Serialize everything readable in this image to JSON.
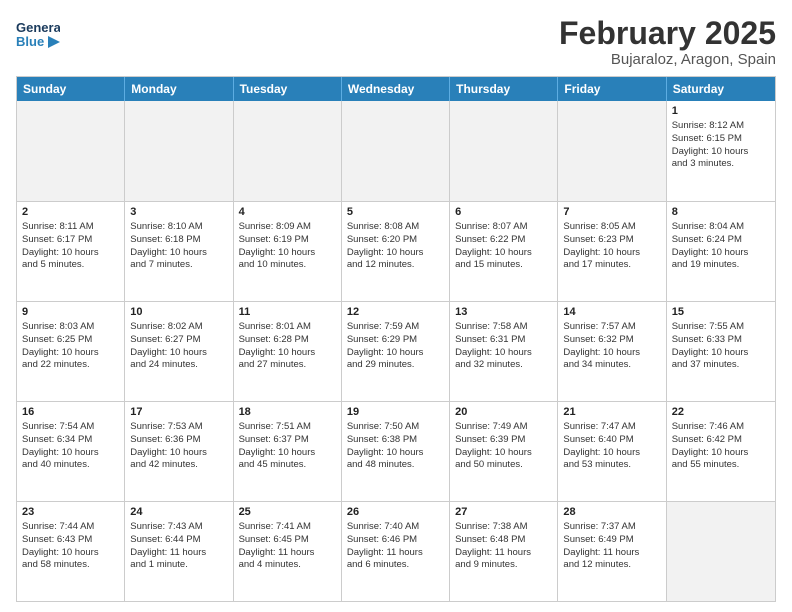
{
  "header": {
    "logo_general": "General",
    "logo_blue": "Blue",
    "month": "February 2025",
    "location": "Bujaraloz, Aragon, Spain"
  },
  "days_of_week": [
    "Sunday",
    "Monday",
    "Tuesday",
    "Wednesday",
    "Thursday",
    "Friday",
    "Saturday"
  ],
  "weeks": [
    [
      {
        "day": "",
        "info": "",
        "shaded": true
      },
      {
        "day": "",
        "info": "",
        "shaded": true
      },
      {
        "day": "",
        "info": "",
        "shaded": true
      },
      {
        "day": "",
        "info": "",
        "shaded": true
      },
      {
        "day": "",
        "info": "",
        "shaded": true
      },
      {
        "day": "",
        "info": "",
        "shaded": true
      },
      {
        "day": "1",
        "info": "Sunrise: 8:12 AM\nSunset: 6:15 PM\nDaylight: 10 hours\nand 3 minutes.",
        "shaded": false
      }
    ],
    [
      {
        "day": "2",
        "info": "Sunrise: 8:11 AM\nSunset: 6:17 PM\nDaylight: 10 hours\nand 5 minutes.",
        "shaded": false
      },
      {
        "day": "3",
        "info": "Sunrise: 8:10 AM\nSunset: 6:18 PM\nDaylight: 10 hours\nand 7 minutes.",
        "shaded": false
      },
      {
        "day": "4",
        "info": "Sunrise: 8:09 AM\nSunset: 6:19 PM\nDaylight: 10 hours\nand 10 minutes.",
        "shaded": false
      },
      {
        "day": "5",
        "info": "Sunrise: 8:08 AM\nSunset: 6:20 PM\nDaylight: 10 hours\nand 12 minutes.",
        "shaded": false
      },
      {
        "day": "6",
        "info": "Sunrise: 8:07 AM\nSunset: 6:22 PM\nDaylight: 10 hours\nand 15 minutes.",
        "shaded": false
      },
      {
        "day": "7",
        "info": "Sunrise: 8:05 AM\nSunset: 6:23 PM\nDaylight: 10 hours\nand 17 minutes.",
        "shaded": false
      },
      {
        "day": "8",
        "info": "Sunrise: 8:04 AM\nSunset: 6:24 PM\nDaylight: 10 hours\nand 19 minutes.",
        "shaded": false
      }
    ],
    [
      {
        "day": "9",
        "info": "Sunrise: 8:03 AM\nSunset: 6:25 PM\nDaylight: 10 hours\nand 22 minutes.",
        "shaded": false
      },
      {
        "day": "10",
        "info": "Sunrise: 8:02 AM\nSunset: 6:27 PM\nDaylight: 10 hours\nand 24 minutes.",
        "shaded": false
      },
      {
        "day": "11",
        "info": "Sunrise: 8:01 AM\nSunset: 6:28 PM\nDaylight: 10 hours\nand 27 minutes.",
        "shaded": false
      },
      {
        "day": "12",
        "info": "Sunrise: 7:59 AM\nSunset: 6:29 PM\nDaylight: 10 hours\nand 29 minutes.",
        "shaded": false
      },
      {
        "day": "13",
        "info": "Sunrise: 7:58 AM\nSunset: 6:31 PM\nDaylight: 10 hours\nand 32 minutes.",
        "shaded": false
      },
      {
        "day": "14",
        "info": "Sunrise: 7:57 AM\nSunset: 6:32 PM\nDaylight: 10 hours\nand 34 minutes.",
        "shaded": false
      },
      {
        "day": "15",
        "info": "Sunrise: 7:55 AM\nSunset: 6:33 PM\nDaylight: 10 hours\nand 37 minutes.",
        "shaded": false
      }
    ],
    [
      {
        "day": "16",
        "info": "Sunrise: 7:54 AM\nSunset: 6:34 PM\nDaylight: 10 hours\nand 40 minutes.",
        "shaded": false
      },
      {
        "day": "17",
        "info": "Sunrise: 7:53 AM\nSunset: 6:36 PM\nDaylight: 10 hours\nand 42 minutes.",
        "shaded": false
      },
      {
        "day": "18",
        "info": "Sunrise: 7:51 AM\nSunset: 6:37 PM\nDaylight: 10 hours\nand 45 minutes.",
        "shaded": false
      },
      {
        "day": "19",
        "info": "Sunrise: 7:50 AM\nSunset: 6:38 PM\nDaylight: 10 hours\nand 48 minutes.",
        "shaded": false
      },
      {
        "day": "20",
        "info": "Sunrise: 7:49 AM\nSunset: 6:39 PM\nDaylight: 10 hours\nand 50 minutes.",
        "shaded": false
      },
      {
        "day": "21",
        "info": "Sunrise: 7:47 AM\nSunset: 6:40 PM\nDaylight: 10 hours\nand 53 minutes.",
        "shaded": false
      },
      {
        "day": "22",
        "info": "Sunrise: 7:46 AM\nSunset: 6:42 PM\nDaylight: 10 hours\nand 55 minutes.",
        "shaded": false
      }
    ],
    [
      {
        "day": "23",
        "info": "Sunrise: 7:44 AM\nSunset: 6:43 PM\nDaylight: 10 hours\nand 58 minutes.",
        "shaded": false
      },
      {
        "day": "24",
        "info": "Sunrise: 7:43 AM\nSunset: 6:44 PM\nDaylight: 11 hours\nand 1 minute.",
        "shaded": false
      },
      {
        "day": "25",
        "info": "Sunrise: 7:41 AM\nSunset: 6:45 PM\nDaylight: 11 hours\nand 4 minutes.",
        "shaded": false
      },
      {
        "day": "26",
        "info": "Sunrise: 7:40 AM\nSunset: 6:46 PM\nDaylight: 11 hours\nand 6 minutes.",
        "shaded": false
      },
      {
        "day": "27",
        "info": "Sunrise: 7:38 AM\nSunset: 6:48 PM\nDaylight: 11 hours\nand 9 minutes.",
        "shaded": false
      },
      {
        "day": "28",
        "info": "Sunrise: 7:37 AM\nSunset: 6:49 PM\nDaylight: 11 hours\nand 12 minutes.",
        "shaded": false
      },
      {
        "day": "",
        "info": "",
        "shaded": true
      }
    ]
  ]
}
